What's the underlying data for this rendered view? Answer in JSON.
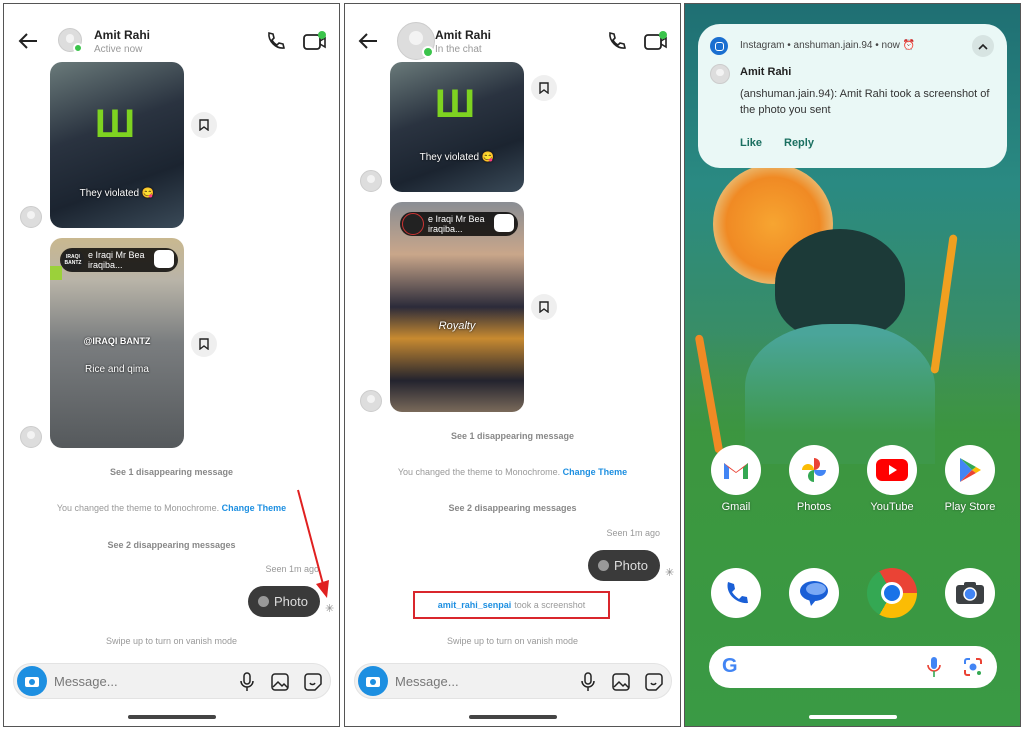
{
  "colors": {
    "accent": "#1d8fe1",
    "online": "#3bc44b",
    "highlight_box": "#d9262c",
    "arrow": "#e02020",
    "notification_bg": "#eaf8f6"
  },
  "panels": [
    {
      "header": {
        "name": "Amit Rahi",
        "status": "Active now"
      },
      "messages": [
        {
          "type": "reel",
          "caption": "They violated 😋"
        },
        {
          "type": "reel",
          "overlay_title": "e Iraqi Mr Bea",
          "overlay_sub": "iraqiba...",
          "watermark": "@IRAQI BANTZ",
          "caption": "Rice and qima",
          "logo": "IRAQI BANTZ"
        }
      ],
      "system": {
        "see_one": "See 1 disappearing message",
        "theme_changed": "You changed the theme to Monochrome.",
        "change_theme": "Change Theme",
        "see_two": "See 2 disappearing messages",
        "seen": "Seen 1m ago",
        "photo": "Photo",
        "vanish": "Swipe up to turn on vanish mode"
      },
      "composer": {
        "placeholder": "Message..."
      }
    },
    {
      "header": {
        "name": "Amit Rahi",
        "status": "In the chat"
      },
      "messages": [
        {
          "type": "reel",
          "caption": "They violated 😋"
        },
        {
          "type": "reel",
          "overlay_title": "e Iraqi Mr Bea",
          "overlay_sub": "iraqiba...",
          "shirt": "Royalty"
        }
      ],
      "system": {
        "see_one": "See 1 disappearing message",
        "theme_changed": "You changed the theme to Monochrome.",
        "change_theme": "Change Theme",
        "see_two": "See 2 disappearing messages",
        "seen": "Seen 1m ago",
        "photo": "Photo",
        "screenshot_user": "amit_rahi_senpai",
        "screenshot_text": "took a screenshot",
        "vanish": "Swipe up to turn on vanish mode"
      },
      "composer": {
        "placeholder": "Message..."
      }
    }
  ],
  "home": {
    "notification": {
      "app": "Instagram",
      "account": "anshuman.jain.94",
      "time": "now",
      "sender": "Amit Rahi",
      "body": "(anshuman.jain.94): Amit Rahi took a screenshot of the photo you sent",
      "actions": [
        "Like",
        "Reply"
      ]
    },
    "apps_row1": [
      {
        "label": "Gmail",
        "icon": "gmail-icon"
      },
      {
        "label": "Photos",
        "icon": "photos-icon"
      },
      {
        "label": "YouTube",
        "icon": "youtube-icon"
      },
      {
        "label": "Play Store",
        "icon": "play-store-icon"
      }
    ],
    "dock": [
      {
        "icon": "phone-icon"
      },
      {
        "icon": "messages-icon"
      },
      {
        "icon": "chrome-icon"
      },
      {
        "icon": "camera-icon"
      }
    ]
  }
}
